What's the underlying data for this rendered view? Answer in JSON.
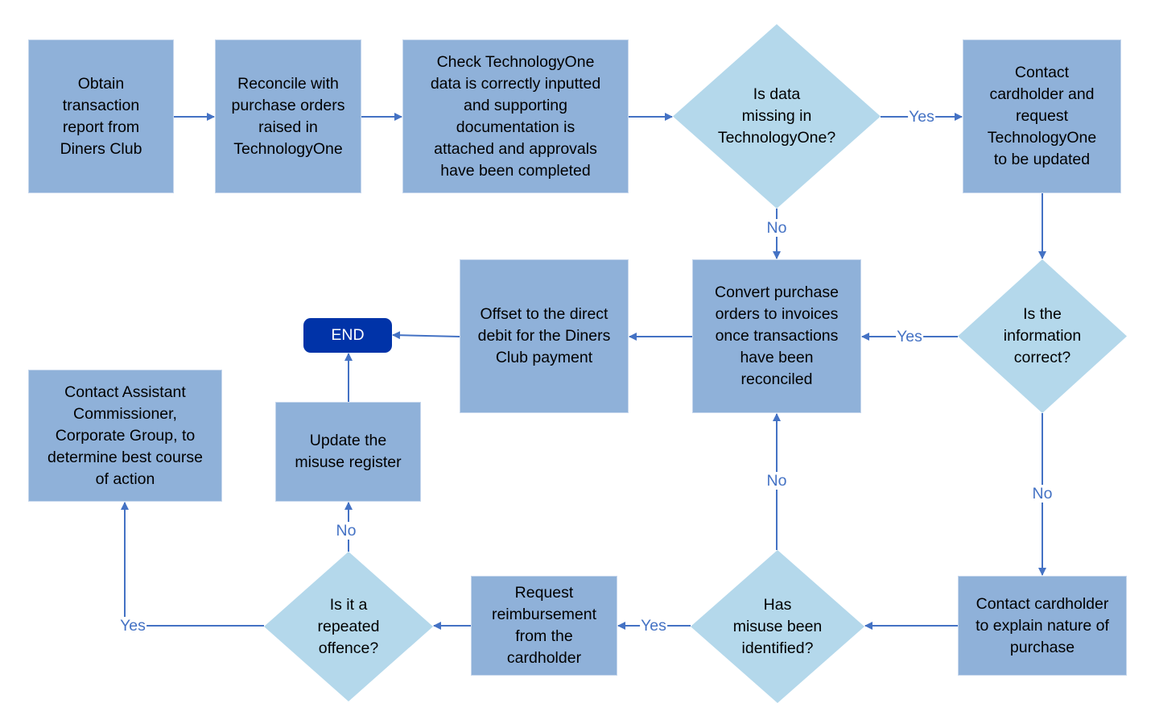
{
  "diagram": {
    "colors": {
      "process_fill": "#8fb1d9",
      "decision_fill": "#b4d8eb",
      "terminal_fill": "#0033a8",
      "connector": "#4472c4"
    },
    "nodes": {
      "obtain_report": {
        "type": "process",
        "label": "Obtain transaction report from Diners Club",
        "lines": [
          "Obtain",
          "transaction",
          "report from",
          "Diners Club"
        ]
      },
      "reconcile": {
        "type": "process",
        "label": "Reconcile with purchase orders raised in TechnologyOne",
        "lines": [
          "Reconcile with",
          "purchase orders",
          "raised in",
          "TechnologyOne"
        ]
      },
      "check_data": {
        "type": "process",
        "label": "Check TechnologyOne data is correctly inputted and supporting documentation is attached and approvals have been completed",
        "lines": [
          "Check TechnologyOne",
          "data is correctly inputted",
          "and supporting",
          "documentation is",
          "attached and approvals",
          "have been completed"
        ]
      },
      "data_missing": {
        "type": "decision",
        "label": "Is data missing in TechnologyOne?",
        "lines": [
          "Is data",
          "missing in",
          "TechnologyOne?"
        ]
      },
      "contact_update": {
        "type": "process",
        "label": "Contact cardholder and request TechnologyOne to be updated",
        "lines": [
          "Contact",
          "cardholder and",
          "request",
          "TechnologyOne",
          "to be updated"
        ]
      },
      "info_correct": {
        "type": "decision",
        "label": "Is the information correct?",
        "lines": [
          "Is the",
          "information",
          "correct?"
        ]
      },
      "convert_po": {
        "type": "process",
        "label": "Convert purchase orders to invoices once transactions have been reconciled",
        "lines": [
          "Convert purchase",
          "orders to invoices",
          "once transactions",
          "have been",
          "reconciled"
        ]
      },
      "offset_debit": {
        "type": "process",
        "label": "Offset to the direct debit for the Diners Club payment",
        "lines": [
          "Offset to the direct",
          "debit for the Diners",
          "Club payment"
        ]
      },
      "end": {
        "type": "terminal",
        "label": "END"
      },
      "contact_explain": {
        "type": "process",
        "label": "Contact cardholder to explain nature of purchase",
        "lines": [
          "Contact cardholder",
          "to explain nature of",
          "purchase"
        ]
      },
      "misuse_identified": {
        "type": "decision",
        "label": "Has misuse been identified?",
        "lines": [
          "Has",
          "misuse been",
          "identified?"
        ]
      },
      "request_reimbursement": {
        "type": "process",
        "label": "Request reimbursement from the cardholder",
        "lines": [
          "Request",
          "reimbursement",
          "from the",
          "cardholder"
        ]
      },
      "repeated_offence": {
        "type": "decision",
        "label": "Is it a repeated offence?",
        "lines": [
          "Is it a",
          "repeated",
          "offence?"
        ]
      },
      "update_register": {
        "type": "process",
        "label": "Update the misuse register",
        "lines": [
          "Update the",
          "misuse register"
        ]
      },
      "contact_commissioner": {
        "type": "process",
        "label": "Contact Assistant Commissioner, Corporate Group, to determine best course of action",
        "lines": [
          "Contact Assistant",
          "Commissioner,",
          "Corporate Group, to",
          "determine best course",
          "of action"
        ]
      }
    },
    "edges": [
      {
        "from": "obtain_report",
        "to": "reconcile",
        "label": ""
      },
      {
        "from": "reconcile",
        "to": "check_data",
        "label": ""
      },
      {
        "from": "check_data",
        "to": "data_missing",
        "label": ""
      },
      {
        "from": "data_missing",
        "to": "contact_update",
        "label": "Yes"
      },
      {
        "from": "data_missing",
        "to": "convert_po",
        "label": "No"
      },
      {
        "from": "contact_update",
        "to": "info_correct",
        "label": ""
      },
      {
        "from": "info_correct",
        "to": "convert_po",
        "label": "Yes"
      },
      {
        "from": "info_correct",
        "to": "contact_explain",
        "label": "No"
      },
      {
        "from": "convert_po",
        "to": "offset_debit",
        "label": ""
      },
      {
        "from": "offset_debit",
        "to": "end",
        "label": ""
      },
      {
        "from": "contact_explain",
        "to": "misuse_identified",
        "label": ""
      },
      {
        "from": "misuse_identified",
        "to": "convert_po",
        "label": "No"
      },
      {
        "from": "misuse_identified",
        "to": "request_reimbursement",
        "label": "Yes"
      },
      {
        "from": "request_reimbursement",
        "to": "repeated_offence",
        "label": ""
      },
      {
        "from": "repeated_offence",
        "to": "update_register",
        "label": "No"
      },
      {
        "from": "repeated_offence",
        "to": "contact_commissioner",
        "label": "Yes"
      },
      {
        "from": "update_register",
        "to": "end",
        "label": ""
      }
    ]
  }
}
